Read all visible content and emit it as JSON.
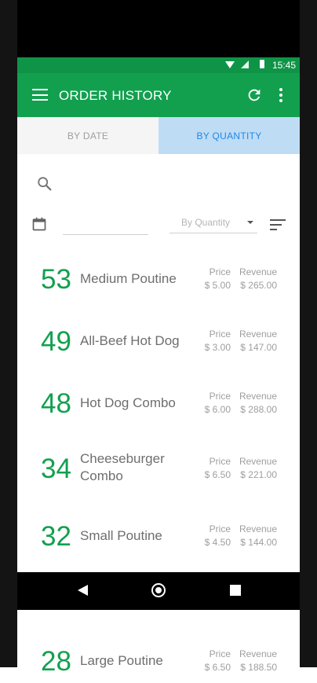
{
  "status_bar": {
    "time": "15:45"
  },
  "app_bar": {
    "title": "ORDER HISTORY"
  },
  "tabs": [
    {
      "label": "BY DATE",
      "active": false
    },
    {
      "label": "BY QUANTITY",
      "active": true
    }
  ],
  "filter": {
    "date_value": "",
    "sort_selected": "By Quantity"
  },
  "column_labels": {
    "price": "Price",
    "revenue": "Revenue"
  },
  "items": [
    {
      "qty": "53",
      "name": "Medium Poutine",
      "price": "$ 5.00",
      "revenue": "$ 265.00"
    },
    {
      "qty": "49",
      "name": "All-Beef Hot  Dog",
      "price": "$ 3.00",
      "revenue": "$ 147.00"
    },
    {
      "qty": "48",
      "name": "Hot Dog Combo",
      "price": "$ 6.00",
      "revenue": "$ 288.00"
    },
    {
      "qty": "34",
      "name": "Cheeseburger Combo",
      "price": "$ 6.50",
      "revenue": "$ 221.00"
    },
    {
      "qty": "32",
      "name": "Small Poutine",
      "price": "$ 4.50",
      "revenue": "$ 144.00"
    },
    {
      "qty": "28",
      "name": "Large Poutine",
      "price": "$ 6.50",
      "revenue": "$ 188.50"
    }
  ],
  "colors": {
    "primary": "#12a04f",
    "status_bar": "#0f9447",
    "active_tab_bg": "#bfdcf5",
    "active_tab_text": "#1e88e5"
  },
  "icons": [
    "menu-icon",
    "refresh-icon",
    "more-vert-icon",
    "search-icon",
    "calendar-icon",
    "sort-icon",
    "back-icon",
    "home-icon",
    "recents-icon"
  ]
}
